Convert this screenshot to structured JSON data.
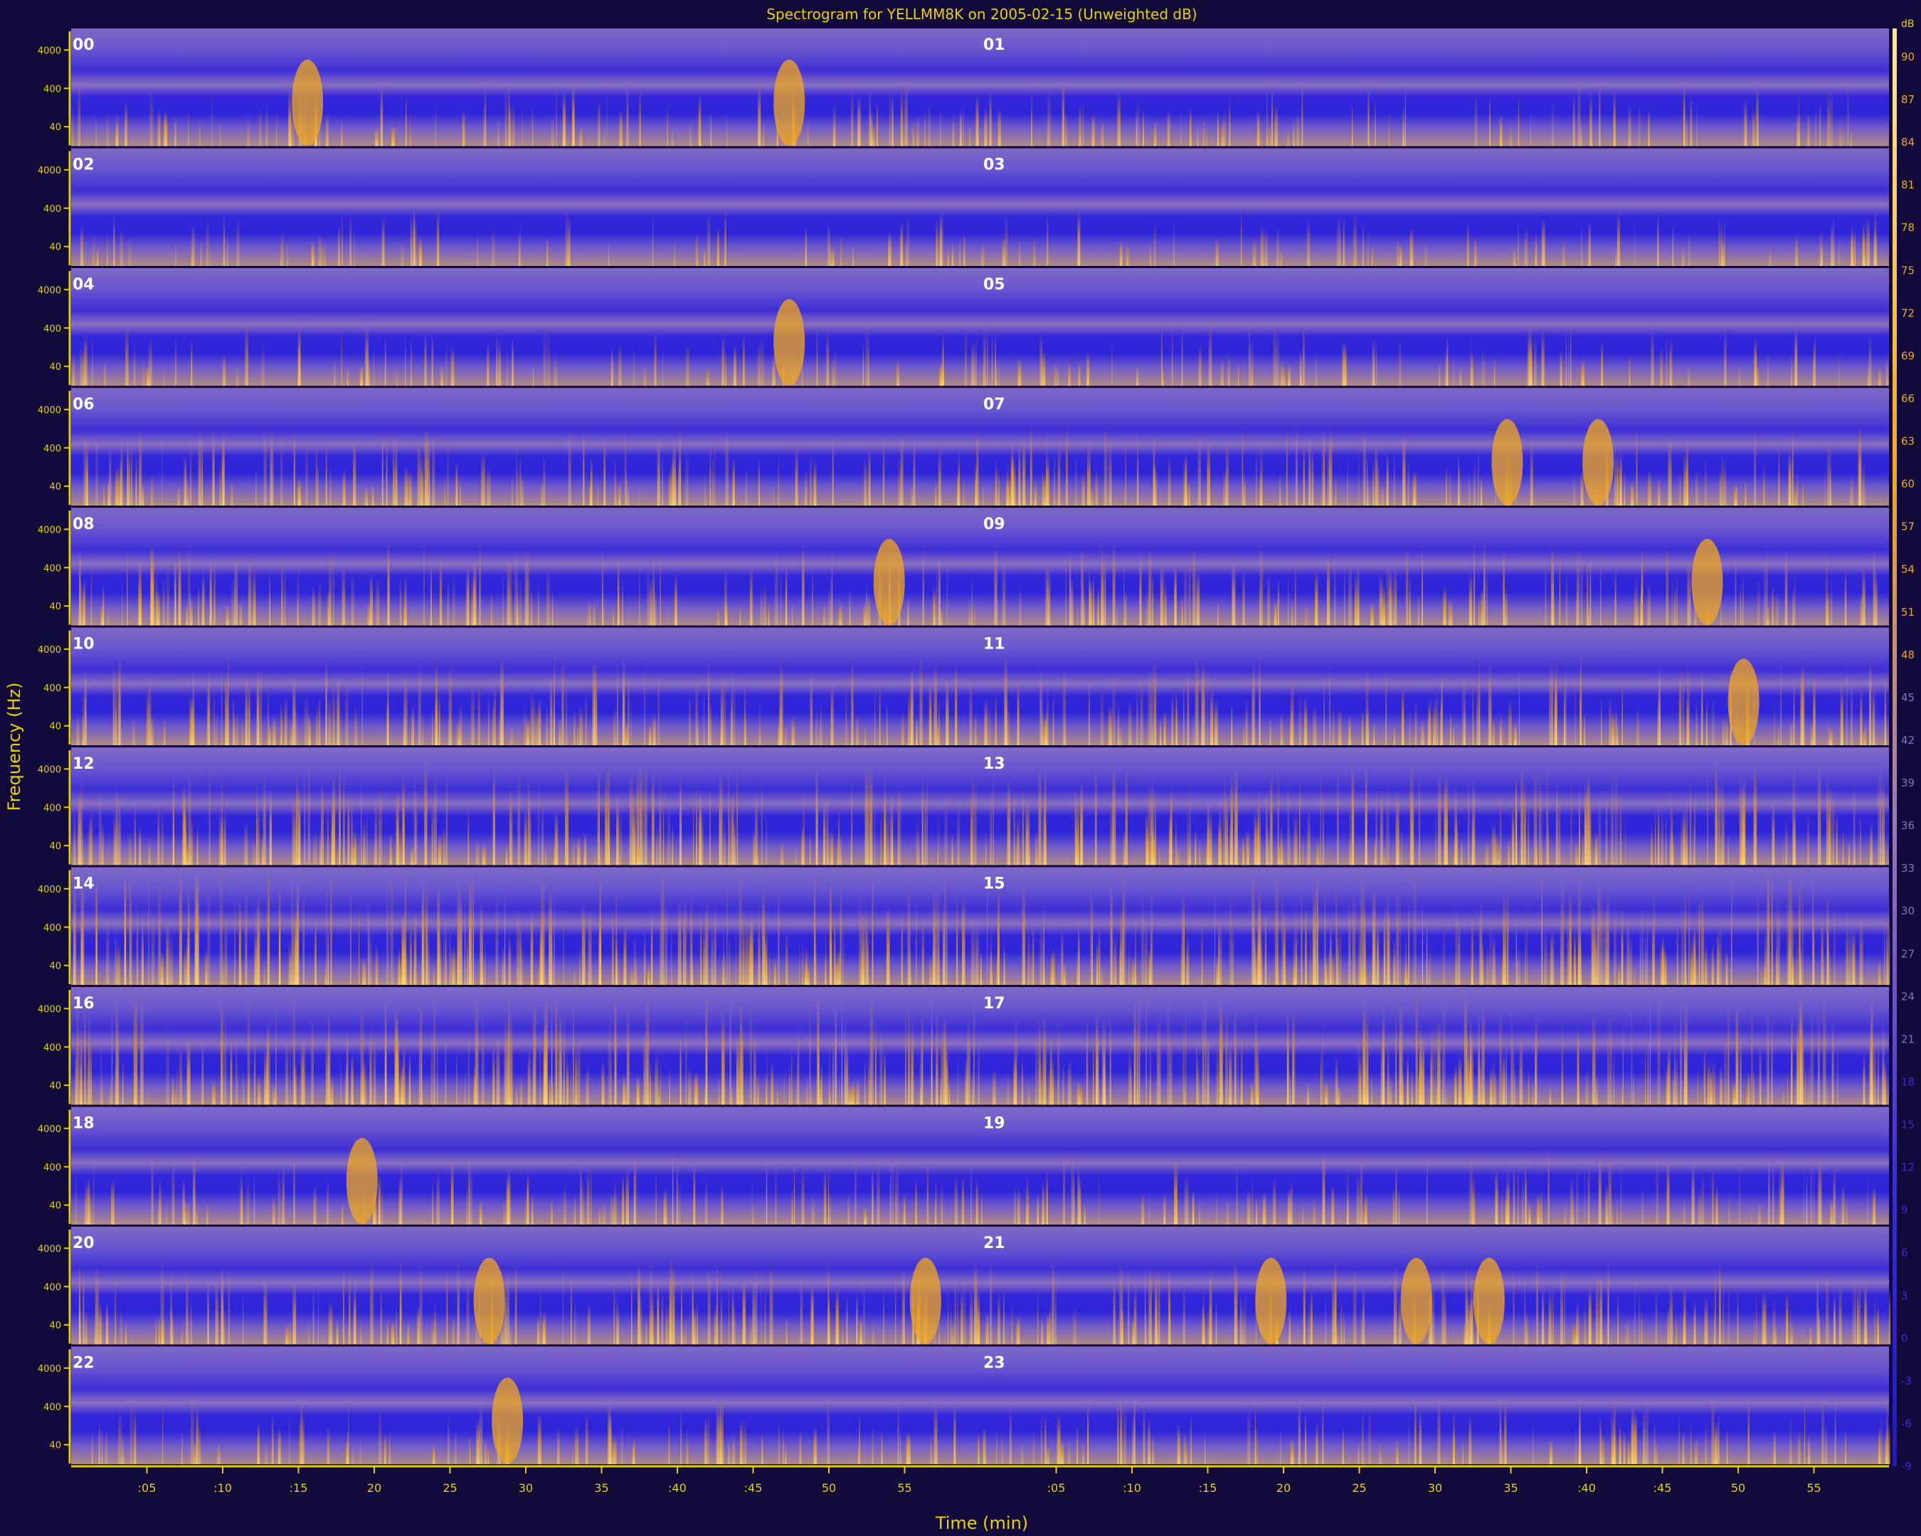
{
  "chart_data": {
    "type": "heatmap",
    "title": "Spectrogram for YELLMM8K on 2005-02-15 (Unweighted dB)",
    "xlabel": "Time (min)",
    "ylabel": "Frequency (Hz)",
    "rows": [
      {
        "left_hour": "00",
        "right_hour": "01"
      },
      {
        "left_hour": "02",
        "right_hour": "03"
      },
      {
        "left_hour": "04",
        "right_hour": "05"
      },
      {
        "left_hour": "06",
        "right_hour": "07"
      },
      {
        "left_hour": "08",
        "right_hour": "09"
      },
      {
        "left_hour": "10",
        "right_hour": "11"
      },
      {
        "left_hour": "12",
        "right_hour": "13"
      },
      {
        "left_hour": "14",
        "right_hour": "15"
      },
      {
        "left_hour": "16",
        "right_hour": "17"
      },
      {
        "left_hour": "18",
        "right_hour": "19"
      },
      {
        "left_hour": "20",
        "right_hour": "21"
      },
      {
        "left_hour": "22",
        "right_hour": "23"
      }
    ],
    "freq_ticks": [
      "40",
      "400",
      "4000"
    ],
    "time_ticks": [
      ":05",
      ":10",
      ":15",
      "20",
      "25",
      "30",
      "35",
      ":40",
      ":45",
      "50",
      "55"
    ],
    "colorbar": {
      "unit": "dB",
      "ticks": [
        90,
        87,
        84,
        81,
        78,
        75,
        72,
        69,
        66,
        63,
        60,
        57,
        54,
        51,
        48,
        45,
        42,
        39,
        36,
        33,
        30,
        27,
        24,
        21,
        18,
        15,
        12,
        9,
        6,
        3,
        0,
        -3,
        -6,
        -9
      ],
      "range": [
        -9,
        90
      ]
    },
    "colors": {
      "background": "#120a3a",
      "low": "#3b2bd8",
      "mid": "#8a70c0",
      "high": "#f2a81e",
      "peak": "#ffe9b0",
      "axis": "#e6d200",
      "label": "#ffffff"
    },
    "grid": false
  }
}
